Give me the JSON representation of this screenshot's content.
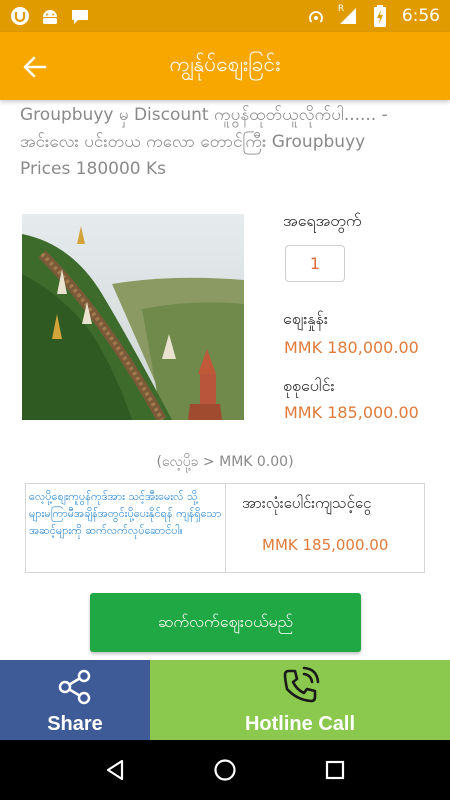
{
  "status_bar": {
    "time": "6:56",
    "icons": [
      "notification-u-icon",
      "android-icon",
      "chat-bubble-icon",
      "hotspot-icon",
      "roaming-signal-icon",
      "battery-charging-icon"
    ],
    "roaming_mark": "R"
  },
  "app_bar": {
    "title": "ကျွန်ုပ်စျေးခြင်း",
    "back_icon": "arrow-left-icon"
  },
  "product": {
    "description": "Groupbuyy မှ Discount ကူပွန်ထုတ်ယူလိုက်ပါ...... - အင်းလေး ပင်းတယ ကလော တောင်ကြီး Groupbuyy Prices 180000 Ks",
    "image_subject": "pagoda-hillside-photo",
    "quantity_label": "အရေအတွက်",
    "quantity_value": "1",
    "price_label": "စျေးနှုန်း",
    "price_value": "MMK 180,000.00",
    "total_label": "စုစုပေါင်း",
    "total_value": "MMK 185,000.00",
    "delivery_note": "(လေ့ပို့ခ > MMK 0.00)"
  },
  "summary": {
    "note": "လေ့ပို့စျေးကူပွန်ကုဒ်အား သင့်အီးမေးလ် သို့ များမကြာမီအချိန်အတွင်းပို့ပေးနိုင်ရန် ကျန်ရှိသော အဆင့်များကို ဆက်လက်လုပ်ဆောင်ပါ။",
    "total_label": "အားလုံးပေါင်းကျသင့်ငွေ",
    "total_value": "MMK 185,000.00"
  },
  "actions": {
    "continue_label": "ဆက်လက်စျေးဝယ်မည်",
    "share_label": "Share",
    "hotline_label": "Hotline Call"
  },
  "colors": {
    "status_bar": "#e09b00",
    "app_bar": "#f7a700",
    "price": "#e07b39",
    "continue_button": "#20a844",
    "share_button": "#3e5a97",
    "hotline_button": "#8bc94e",
    "note_text": "#1b7fd3"
  },
  "nav_bar": {
    "icons": [
      "back-triangle-icon",
      "home-circle-icon",
      "recents-square-icon"
    ]
  }
}
